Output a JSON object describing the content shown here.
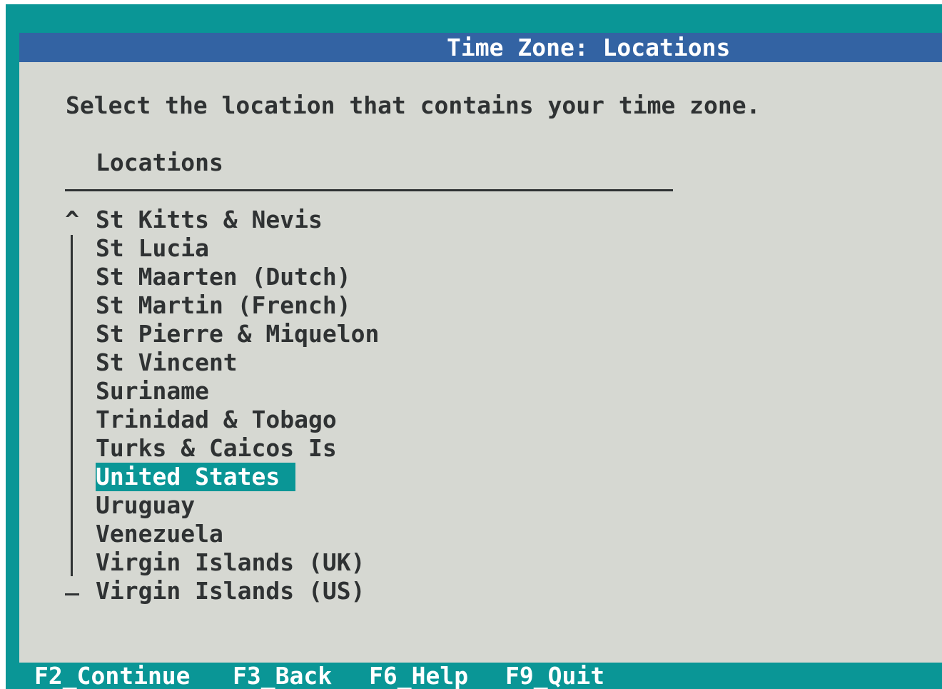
{
  "title": "Time Zone: Locations",
  "prompt": "Select the location that contains your time zone.",
  "list": {
    "header": "Locations",
    "scroll_up_indicator": "^",
    "selected_index": 9,
    "items": [
      "St Kitts & Nevis",
      "St Lucia",
      "St Maarten (Dutch)",
      "St Martin (French)",
      "St Pierre & Miquelon",
      "St Vincent",
      "Suriname",
      "Trinidad & Tobago",
      "Turks & Caicos Is",
      "United States",
      "Uruguay",
      "Venezuela",
      "Virgin Islands (UK)",
      "Virgin Islands (US)"
    ]
  },
  "footer": {
    "continue": "F2_Continue",
    "back": "F3_Back",
    "help": "F6_Help",
    "quit": "F9_Quit"
  },
  "colors": {
    "background": "#0a9696",
    "dialog": "#d6d8d2",
    "titlebar": "#3363a3",
    "text": "#2f3233",
    "highlight": "#0a9696",
    "highlight_text": "#ffffff"
  }
}
